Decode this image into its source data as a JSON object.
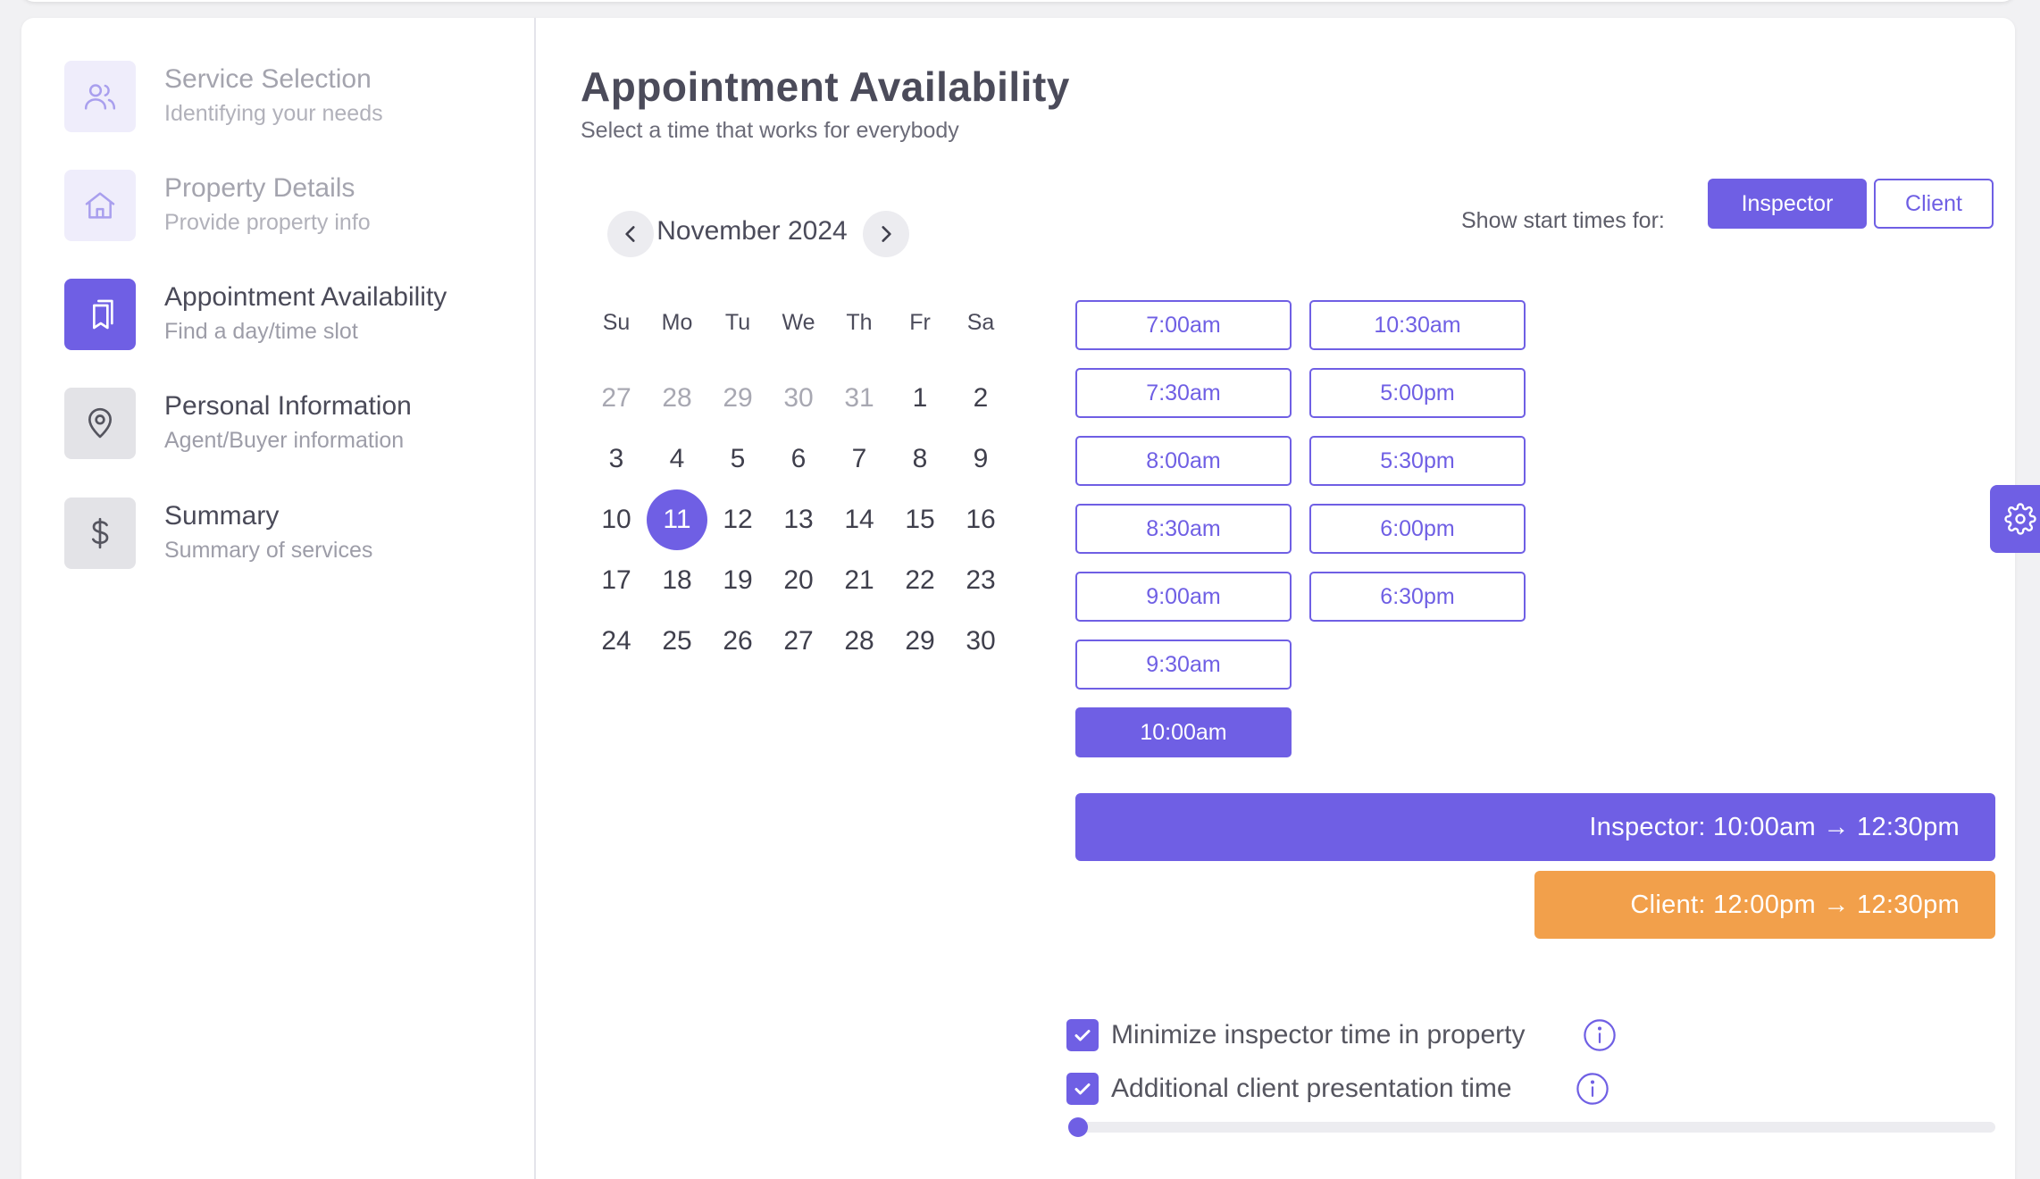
{
  "colors": {
    "accent": "#6f5fe4",
    "client_bar": "#f2a04b",
    "muted_text": "#a8a8b2"
  },
  "sidebar": {
    "steps": [
      {
        "title": "Service Selection",
        "subtitle": "Identifying your needs",
        "icon": "users-icon",
        "state": "done"
      },
      {
        "title": "Property Details",
        "subtitle": "Provide property info",
        "icon": "home-icon",
        "state": "done"
      },
      {
        "title": "Appointment Availability",
        "subtitle": "Find a day/time slot",
        "icon": "bookmarks-icon",
        "state": "current"
      },
      {
        "title": "Personal Information",
        "subtitle": "Agent/Buyer information",
        "icon": "map-pin-icon",
        "state": "pending"
      },
      {
        "title": "Summary",
        "subtitle": "Summary of services",
        "icon": "dollar-icon",
        "state": "pending"
      }
    ]
  },
  "main": {
    "title": "Appointment Availability",
    "subtitle": "Select a time that works for everybody"
  },
  "calendar": {
    "month_label": "November 2024",
    "weekdays": [
      "Su",
      "Mo",
      "Tu",
      "We",
      "Th",
      "Fr",
      "Sa"
    ],
    "weeks": [
      [
        "27",
        "28",
        "29",
        "30",
        "31",
        "1",
        "2"
      ],
      [
        "3",
        "4",
        "5",
        "6",
        "7",
        "8",
        "9"
      ],
      [
        "10",
        "11",
        "12",
        "13",
        "14",
        "15",
        "16"
      ],
      [
        "17",
        "18",
        "19",
        "20",
        "21",
        "22",
        "23"
      ],
      [
        "24",
        "25",
        "26",
        "27",
        "28",
        "29",
        "30"
      ]
    ],
    "muted_count_first_week": 5,
    "selected_day": "11"
  },
  "start_times": {
    "label": "Show start times for:",
    "inspector_label": "Inspector",
    "client_label": "Client",
    "active": "Inspector"
  },
  "time_slots": {
    "column1": [
      "7:00am",
      "7:30am",
      "8:00am",
      "8:30am",
      "9:00am",
      "9:30am",
      "10:00am"
    ],
    "column2": [
      "10:30am",
      "5:00pm",
      "5:30pm",
      "6:00pm",
      "6:30pm"
    ],
    "selected": "10:00am"
  },
  "summary_bars": {
    "inspector": "Inspector: 10:00am → 12:30pm",
    "client": "Client: 12:00pm → 12:30pm"
  },
  "options": {
    "minimize_label": "Minimize inspector time in property",
    "minimize_checked": true,
    "presentation_label": "Additional client presentation time",
    "presentation_checked": true
  },
  "presentation_slider": {
    "value_fraction": 0
  }
}
